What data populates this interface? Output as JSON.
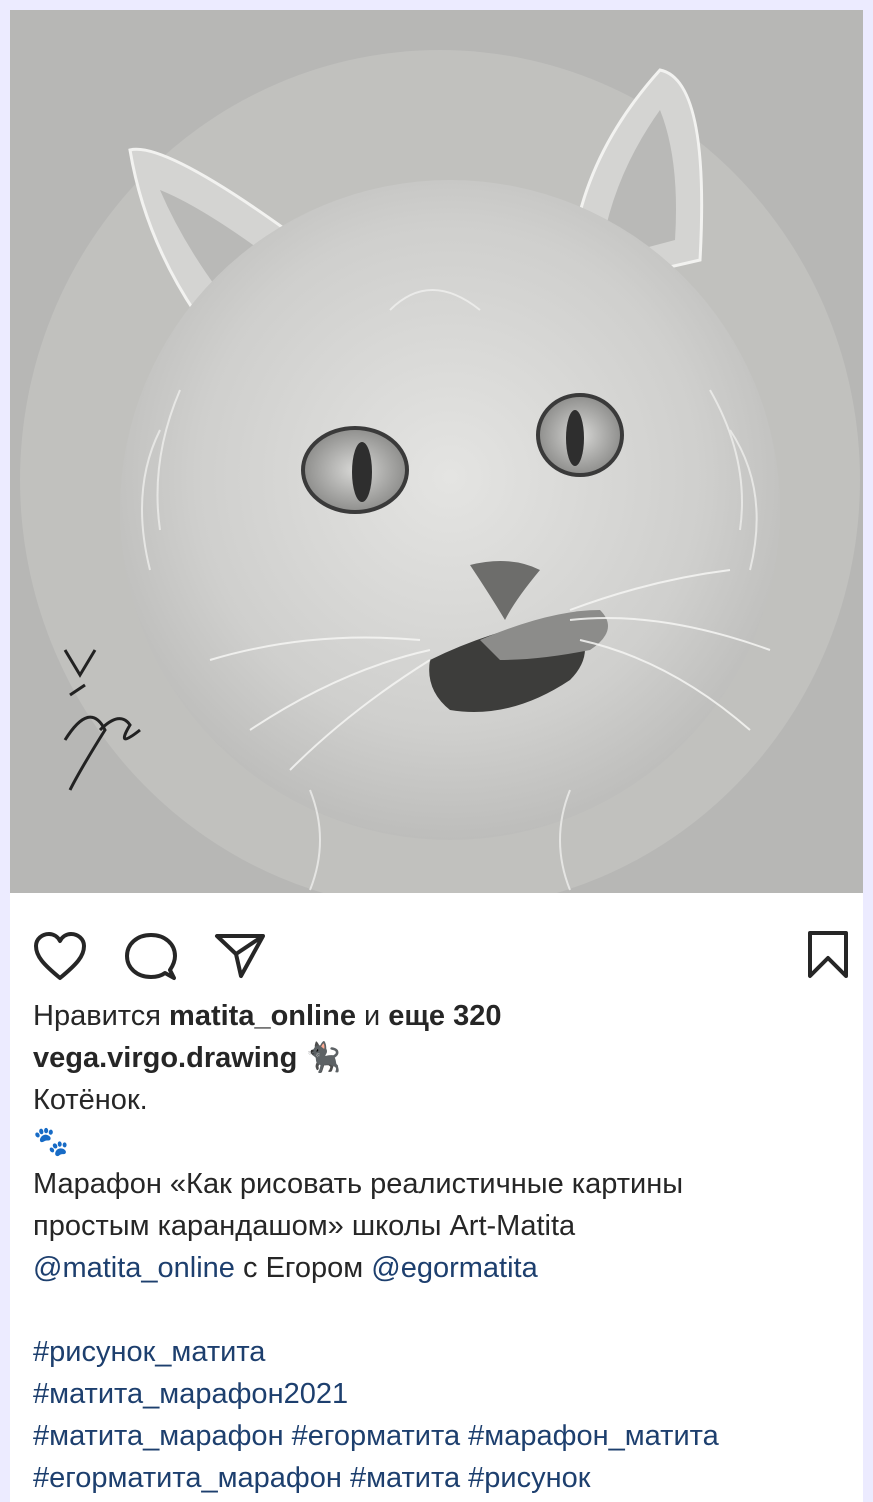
{
  "post": {
    "image_name": "pencil-kitten-drawing",
    "signature_text": "V '21",
    "likes": {
      "prefix": "Нравится",
      "user": "matita_online",
      "mid": "и",
      "rest": "еще 320"
    },
    "author": "vega.virgo.drawing",
    "author_emoji": "🐈‍⬛",
    "caption_title": "Котёнок.",
    "caption_emoji": "🐾",
    "caption_line1": "Марафон «Как рисовать реалистичные картины",
    "caption_line2": "простым карандашом» школы Art-Matita",
    "mention1": "@matita_online",
    "mid_text": "с Егором",
    "mention2": "@egormatita",
    "hashtag1": "#рисунок_матита",
    "hashtag2": "#матита_марафон2021",
    "hashtag3a": "#матита_марафон",
    "hashtag3b": "#егорматита",
    "hashtag3c": "#марафон_матита",
    "hashtag4a": "#егорматита_марафон",
    "hashtag4b": "#матита",
    "hashtag4c": "#рисунок"
  },
  "icons": {
    "like": "heart-icon",
    "comment": "comment-bubble-icon",
    "share": "send-paper-plane-icon",
    "save": "bookmark-icon"
  },
  "colors": {
    "background": "#ecebff",
    "text": "#262626",
    "link": "#1d3f6e"
  }
}
